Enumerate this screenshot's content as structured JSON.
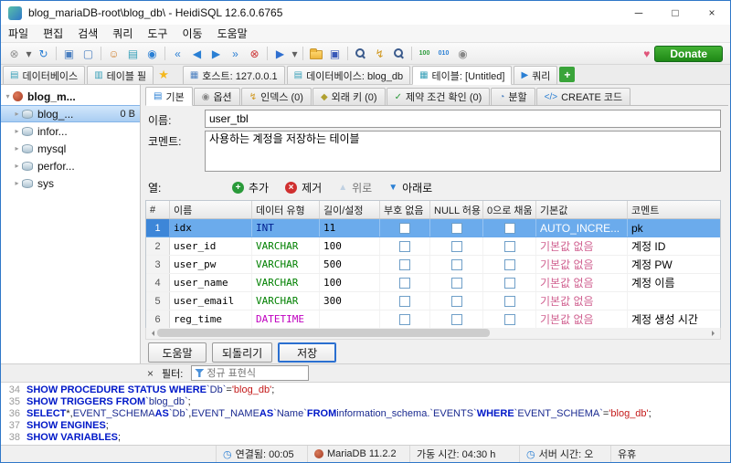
{
  "window": {
    "title": "blog_mariaDB-root\\blog_db\\ - HeidiSQL 12.6.0.6765",
    "controls": {
      "minimize": "─",
      "maximize": "□",
      "close": "×"
    }
  },
  "menu": {
    "items": [
      "파일",
      "편집",
      "검색",
      "쿼리",
      "도구",
      "이동",
      "도움말"
    ]
  },
  "toolbar": {
    "donate_label": "Donate",
    "icons": [
      {
        "name": "disconnect-icon",
        "glyph": "⊗",
        "color": "#909090"
      },
      {
        "name": "connect-caret-icon",
        "glyph": "▾",
        "color": "#606060",
        "narrow": true
      },
      {
        "name": "refresh-icon",
        "glyph": "↻",
        "color": "#2a7fd4"
      },
      {
        "sep": true
      },
      {
        "name": "session-manager-icon",
        "glyph": "▣",
        "color": "#4a7fc0"
      },
      {
        "name": "new-window-icon",
        "glyph": "▢",
        "color": "#4a7fc0"
      },
      {
        "sep": true
      },
      {
        "name": "user-manager-icon",
        "glyph": "☺",
        "color": "#d08030"
      },
      {
        "name": "database-manager-icon",
        "glyph": "▤",
        "color": "#38a0b8"
      },
      {
        "name": "server-info-icon",
        "glyph": "◉",
        "color": "#2a7fd4"
      },
      {
        "sep": true
      },
      {
        "name": "first-record-icon",
        "glyph": "«",
        "color": "#2a7fd4"
      },
      {
        "name": "prev-record-icon",
        "glyph": "◀",
        "color": "#2a7fd4"
      },
      {
        "name": "next-record-icon",
        "glyph": "▶",
        "color": "#2a7fd4"
      },
      {
        "name": "last-record-icon",
        "glyph": "»",
        "color": "#2a7fd4"
      },
      {
        "name": "stop-icon",
        "glyph": "⊗",
        "color": "#cc3333"
      },
      {
        "sep": true
      },
      {
        "name": "run-query-icon",
        "glyph": "▶",
        "color": "#2f6fd0"
      },
      {
        "name": "run-caret-icon",
        "glyph": "▾",
        "color": "#606060",
        "narrow": true
      },
      {
        "sep": true
      },
      {
        "name": "open-file-icon",
        "kind": "folder"
      },
      {
        "name": "save-icon",
        "glyph": "▣",
        "color": "#3858b8"
      },
      {
        "sep": true
      },
      {
        "name": "search-icon",
        "kind": "mag"
      },
      {
        "name": "quick-filter-icon",
        "glyph": "↯",
        "color": "#d09820"
      },
      {
        "name": "find-replace-icon",
        "kind": "mag"
      },
      {
        "sep": true
      },
      {
        "name": "binary-100-icon",
        "glyph": "100",
        "color": "#2a9a3a",
        "badge": true
      },
      {
        "name": "binary-010-icon",
        "glyph": "010",
        "color": "#2a7fd4",
        "badge": true
      },
      {
        "name": "preferences-icon",
        "glyph": "◉",
        "color": "#888888"
      }
    ]
  },
  "panel_tabs": {
    "tabs": [
      {
        "name": "left-tab-database-tree",
        "label": "데이터베이스",
        "glyph": "▤",
        "color": "#38a0b8"
      },
      {
        "name": "left-tab-table-filter",
        "label": "테이블 필",
        "glyph": "▥",
        "color": "#38a0b8"
      }
    ],
    "star_glyph": "★"
  },
  "session_tabs": {
    "tabs": [
      {
        "name": "tab-host",
        "label": "호스트: 127.0.0.1",
        "glyph": "▦",
        "color": "#4a7fc0"
      },
      {
        "name": "tab-database",
        "label": "데이터베이스: blog_db",
        "glyph": "▤",
        "color": "#38a0b8"
      },
      {
        "name": "tab-table",
        "label": "테이블: [Untitled]",
        "glyph": "▦",
        "color": "#38a0b8",
        "active": true
      },
      {
        "name": "tab-query",
        "label": "쿼리",
        "glyph": "▶",
        "color": "#2a7fd4"
      }
    ],
    "add_glyph": "+"
  },
  "tree": {
    "items": [
      {
        "label": "blog_m...",
        "level": 0,
        "caret": "▾",
        "icon": "seal",
        "bold": true
      },
      {
        "label": "blog_...",
        "level": 1,
        "caret": "▸",
        "icon": "db",
        "selected": true,
        "size": "0 B"
      },
      {
        "label": "infor...",
        "level": 1,
        "caret": "▸",
        "icon": "db"
      },
      {
        "label": "mysql",
        "level": 1,
        "caret": "▸",
        "icon": "db"
      },
      {
        "label": "perfor...",
        "level": 1,
        "caret": "▸",
        "icon": "db"
      },
      {
        "label": "sys",
        "level": 1,
        "caret": "▸",
        "icon": "db"
      }
    ]
  },
  "editor": {
    "tabs": [
      {
        "label": "기본",
        "glyph": "▤",
        "color": "#2a7fd4",
        "active": true
      },
      {
        "label": "옵션",
        "glyph": "◉",
        "color": "#888888"
      },
      {
        "label": "인덱스 (0)",
        "glyph": "↯",
        "color": "#d09820"
      },
      {
        "label": "외래 키 (0)",
        "glyph": "◆",
        "color": "#b0a030"
      },
      {
        "label": "제약 조건 확인 (0)",
        "glyph": "✓",
        "color": "#2a9a3a"
      },
      {
        "label": "분할",
        "glyph": "◔",
        "color": "#4a7fc0"
      },
      {
        "label": "CREATE 코드",
        "glyph": "</>",
        "color": "#2a7fd4"
      }
    ],
    "name_label": "이름:",
    "name_value": "user_tbl",
    "comment_label": "코멘트:",
    "comment_value": "사용하는 계정을 저장하는 테이블",
    "columns_label": "열:",
    "col_buttons": [
      {
        "name": "add-column-button",
        "label": "추가",
        "glyph": "+",
        "color": "#2a9a3a",
        "circle": true
      },
      {
        "name": "remove-column-button",
        "label": "제거",
        "glyph": "×",
        "color": "#d03030",
        "circle": true
      },
      {
        "name": "move-up-button",
        "label": "위로",
        "glyph": "▲",
        "color": "#9ab8d8",
        "disabled": true
      },
      {
        "name": "move-down-button",
        "label": "아래로",
        "glyph": "▼",
        "color": "#2a7fd4"
      }
    ],
    "grid": {
      "headers": [
        "#",
        "이름",
        "데이터 유형",
        "길이/설정",
        "부호 없음",
        "NULL 허용",
        "0으로 채움",
        "기본값",
        "코멘트"
      ],
      "rows": [
        {
          "num": "1",
          "name": "idx",
          "type": "INT",
          "type_color": "#002090",
          "length": "11",
          "default": "AUTO_INCRE...",
          "default_color": "#ffffff",
          "comment": "pk",
          "selected": true
        },
        {
          "num": "2",
          "name": "user_id",
          "type": "VARCHAR",
          "type_color": "#008000",
          "length": "100",
          "default": "기본값 없음",
          "default_color": "#d06090",
          "comment": "계정 ID"
        },
        {
          "num": "3",
          "name": "user_pw",
          "type": "VARCHAR",
          "type_color": "#008000",
          "length": "500",
          "default": "기본값 없음",
          "default_color": "#d06090",
          "comment": "계정 PW"
        },
        {
          "num": "4",
          "name": "user_name",
          "type": "VARCHAR",
          "type_color": "#008000",
          "length": "100",
          "default": "기본값 없음",
          "default_color": "#d06090",
          "comment": "계정 이름"
        },
        {
          "num": "5",
          "name": "user_email",
          "type": "VARCHAR",
          "type_color": "#008000",
          "length": "300",
          "default": "기본값 없음",
          "default_color": "#d06090",
          "comment": ""
        },
        {
          "num": "6",
          "name": "reg_time",
          "type": "DATETIME",
          "type_color": "#c000c0",
          "length": "",
          "default": "기본값 없음",
          "default_color": "#d06090",
          "comment": "계정 생성 시간"
        }
      ]
    },
    "action_buttons": [
      {
        "name": "help-button",
        "label": "도움말"
      },
      {
        "name": "revert-button",
        "label": "되돌리기"
      },
      {
        "name": "save-button",
        "label": "저장",
        "default": true
      }
    ]
  },
  "filter_bar": {
    "close_glyph": "×",
    "label": "필터:",
    "placeholder": "정규 표현식"
  },
  "sql_log": {
    "lines": [
      {
        "num": "34",
        "segs": [
          [
            "kw",
            "SHOW PROCEDURE STATUS WHERE "
          ],
          [
            "id",
            "`Db`"
          ],
          [
            "pl",
            "="
          ],
          [
            "str",
            "'blog_db'"
          ],
          [
            "pl",
            ";"
          ]
        ]
      },
      {
        "num": "35",
        "segs": [
          [
            "kw",
            "SHOW TRIGGERS FROM "
          ],
          [
            "id",
            "`blog_db`"
          ],
          [
            "pl",
            ";"
          ]
        ]
      },
      {
        "num": "36",
        "segs": [
          [
            "kw",
            "SELECT "
          ],
          [
            "pl",
            "*, "
          ],
          [
            "id",
            "EVENT_SCHEMA "
          ],
          [
            "kw",
            "AS "
          ],
          [
            "id",
            "`Db`"
          ],
          [
            "pl",
            ", "
          ],
          [
            "id",
            "EVENT_NAME "
          ],
          [
            "kw",
            "AS "
          ],
          [
            "id",
            "`Name` "
          ],
          [
            "kw",
            "FROM "
          ],
          [
            "id",
            "information_schema.`EVENTS` "
          ],
          [
            "kw",
            "WHERE "
          ],
          [
            "id",
            "`EVENT_SCHEMA`"
          ],
          [
            "pl",
            "="
          ],
          [
            "str",
            "'blog_db'"
          ],
          [
            "pl",
            ";"
          ]
        ]
      },
      {
        "num": "37",
        "segs": [
          [
            "kw",
            "SHOW ENGINES"
          ],
          [
            "pl",
            ";"
          ]
        ]
      },
      {
        "num": "38",
        "segs": [
          [
            "kw",
            "SHOW VARIABLES"
          ],
          [
            "pl",
            ";"
          ]
        ]
      }
    ]
  },
  "status_bar": {
    "segments": [
      {
        "name": "pane-blank",
        "text": ""
      },
      {
        "name": "pane-connected",
        "glyph": "◷",
        "text": "연결됨: 00:05"
      },
      {
        "name": "pane-version",
        "icon": "seal",
        "text": "MariaDB 11.2.2"
      },
      {
        "name": "pane-uptime",
        "text": "가동 시간: 04:30 h"
      },
      {
        "name": "pane-server-time",
        "glyph": "◷",
        "text": "서버 시간: 오"
      },
      {
        "name": "pane-idle",
        "text": "유휴"
      }
    ]
  }
}
